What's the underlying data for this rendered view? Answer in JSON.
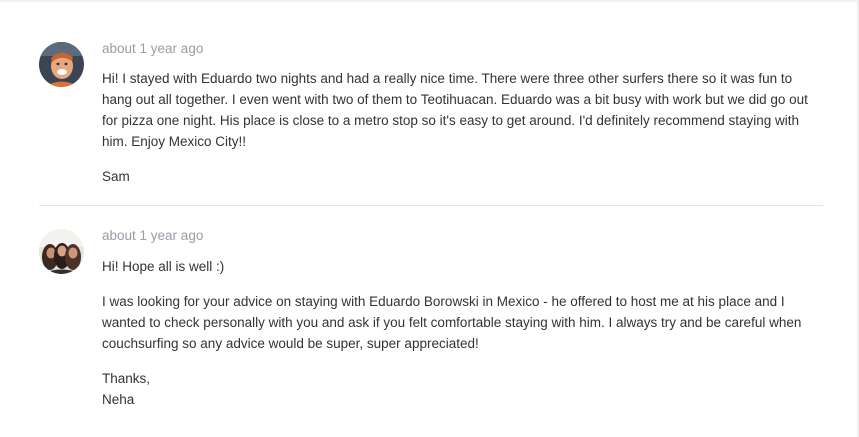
{
  "messages": [
    {
      "avatar_icon": "profile-photo-man-icon",
      "timestamp": "about 1 year ago",
      "paragraphs": [
        "Hi! I stayed with Eduardo two nights and had a really nice time. There were three other surfers there so it was fun to hang out all together. I even went with two of them to Teotihuacan. Eduardo was a bit busy with work but we did go out for pizza one night. His place is close to a metro stop so it's easy to get around. I'd definitely recommend staying with him. Enjoy Mexico City!!",
        "Sam"
      ]
    },
    {
      "avatar_icon": "profile-photo-group-icon",
      "timestamp": "about 1 year ago",
      "paragraphs": [
        "Hi! Hope all is well :)",
        "I was looking for your advice on staying with Eduardo Borowski in Mexico - he offered to host me at his place and I wanted to check personally with you and ask if you felt comfortable staying with him. I always try and be careful when couchsurfing so any advice would be super, super appreciated!",
        "Thanks,\nNeha"
      ]
    }
  ],
  "colors": {
    "timestamp": "#979ea6",
    "text": "#333333",
    "divider": "#e6e6e6"
  }
}
